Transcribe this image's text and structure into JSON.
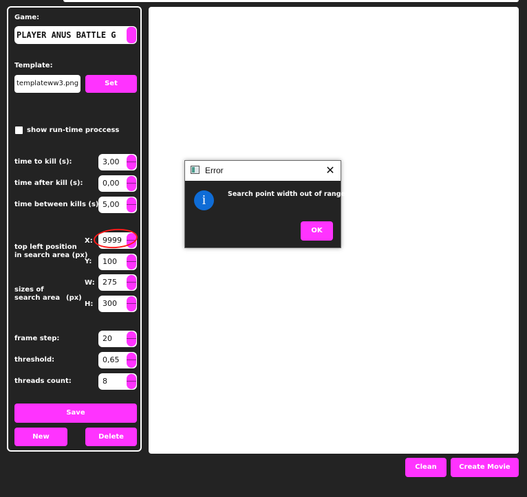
{
  "panel": {
    "game_label": "Game:",
    "game_value": "PLAYER ANUS BATTLE G",
    "template_label": "Template:",
    "template_value": "templateww3.png",
    "set_button": "Set",
    "show_runtime_label": "show run-time proccess",
    "show_runtime_checked": false,
    "time_to_kill_label": "time to kill (s):",
    "time_to_kill_value": "3,00",
    "time_after_kill_label": "time after kill (s):",
    "time_after_kill_value": "0,00",
    "time_between_kills_label": "time between kills (s):",
    "time_between_kills_value": "5,00",
    "position_label_line1": "top left position",
    "position_label_line2": "in search area (px)",
    "x_label": "X:",
    "x_value": "9999",
    "y_label": "Y:",
    "y_value": "100",
    "sizes_label_line1": "sizes of",
    "sizes_label_line2": "search area",
    "sizes_unit": "(px)",
    "w_label": "W:",
    "w_value": "275",
    "h_label": "H:",
    "h_value": "300",
    "frame_step_label": "frame step:",
    "frame_step_value": "20",
    "threshold_label": "threshold:",
    "threshold_value": "0,65",
    "threads_label": "threads count:",
    "threads_value": "8",
    "save_button": "Save",
    "new_button": "New",
    "delete_button": "Delete"
  },
  "bottom": {
    "clean_button": "Clean",
    "create_movie_button": "Create Movie"
  },
  "dialog": {
    "title": "Error",
    "close_glyph": "✕",
    "info_glyph": "i",
    "message": "Search point width out of range!",
    "ok_button": "OK"
  },
  "colors": {
    "accent": "#ff33ff",
    "background": "#232323",
    "highlight_circle": "#ff1a1a",
    "info_icon": "#0f6cd6"
  }
}
